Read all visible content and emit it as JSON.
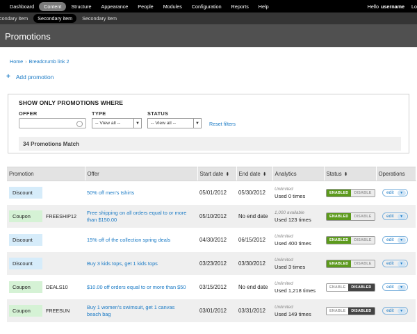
{
  "topnav": {
    "items": [
      "Dashboard",
      "Content",
      "Structure",
      "Appearance",
      "People",
      "Modules",
      "Configuration",
      "Reports",
      "Help"
    ],
    "active_index": 1,
    "greeting": "Hello",
    "username": "username",
    "logout": "Lo"
  },
  "subnav": {
    "items": [
      "condary item",
      "Secondary item",
      "Secondary item"
    ],
    "active_index": 1
  },
  "page_title": "Promotions",
  "breadcrumb": {
    "home": "Home",
    "link2": "Breadcrumb link 2"
  },
  "add_promotion": "Add promotion",
  "filters": {
    "title": "SHOW ONLY PROMOTIONS WHERE",
    "offer_label": "OFFER",
    "offer_value": "",
    "type_label": "TYPE",
    "type_value": "-- View all --",
    "status_label": "STATUS",
    "status_value": "-- View all --",
    "reset": "Reset filters",
    "match_count": "34 Promotions Match"
  },
  "table": {
    "headers": [
      "Promotion",
      "Offer",
      "Start date",
      "End date",
      "Analytics",
      "Status",
      "Operations"
    ],
    "rows": [
      {
        "type": "Discount",
        "code": "",
        "offer": "50% off men's tshirts",
        "start": "05/01/2012",
        "end": "05/30/2012",
        "avail": "Unlimited",
        "used": "Used 0 times",
        "enabled": true
      },
      {
        "type": "Coupon",
        "code": "FREESHIP12",
        "offer": "Free shipping on all orders equal to or more than $150.00",
        "start": "05/10/2012",
        "end": "No end date",
        "avail": "1,000 available",
        "used": "Used 123 times",
        "enabled": true
      },
      {
        "type": "Discount",
        "code": "",
        "offer": "15% off of the collection spring deals",
        "start": "04/30/2012",
        "end": "06/15/2012",
        "avail": "Unlimited",
        "used": "Used 400 times",
        "enabled": true
      },
      {
        "type": "Discount",
        "code": "",
        "offer": "Buy 3 kids tops, get 1 kids tops",
        "start": "03/23/2012",
        "end": "03/30/2012",
        "avail": "Unlimited",
        "used": "Used 3 times",
        "enabled": true
      },
      {
        "type": "Coupon",
        "code": "DEALS10",
        "offer": "$10.00 off orders equal to or more than $50",
        "start": "03/15/2012",
        "end": "No end date",
        "avail": "Unlimited",
        "used": "Used 1,218 times",
        "enabled": false
      },
      {
        "type": "Coupon",
        "code": "FREESUN",
        "offer": "Buy 1 women's swimsuit, get 1 canvas beach bag",
        "start": "03/01/2012",
        "end": "03/31/2012",
        "avail": "Unlimited",
        "used": "Used 149 times",
        "enabled": false
      }
    ],
    "enable_label": "ENABLED",
    "disable_label": "DISABLE",
    "enable_off_label": "ENABLE",
    "disabled_label": "DISABLED",
    "edit_label": "edit"
  },
  "colors": {
    "accent": "#1a7ac5",
    "enabled": "#5c9a1c",
    "disabled": "#444444"
  }
}
